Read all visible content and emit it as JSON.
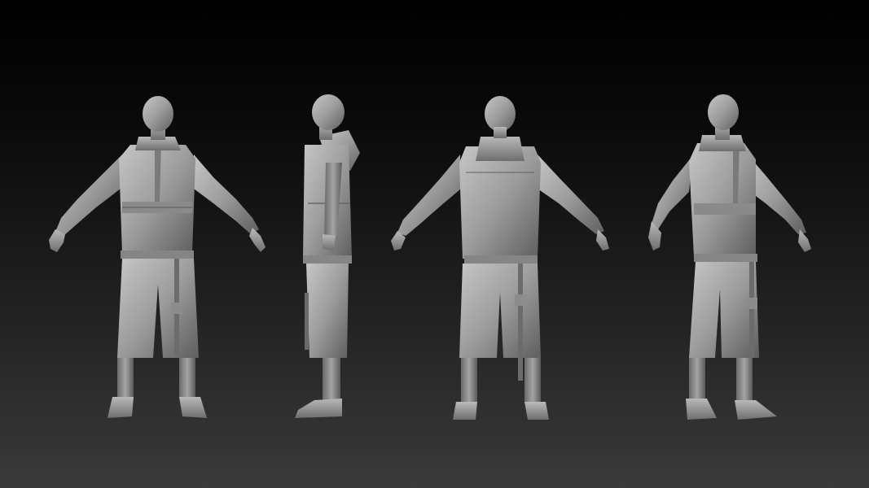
{
  "scene": {
    "background_top": "#000000",
    "background_bottom": "#3a3a3a",
    "material_color": "#9a9a9a",
    "material_highlight": "#c4c4c4",
    "material_shadow": "#4a4a4a",
    "views": [
      {
        "name": "front"
      },
      {
        "name": "side"
      },
      {
        "name": "back"
      },
      {
        "name": "three-quarter"
      }
    ]
  }
}
